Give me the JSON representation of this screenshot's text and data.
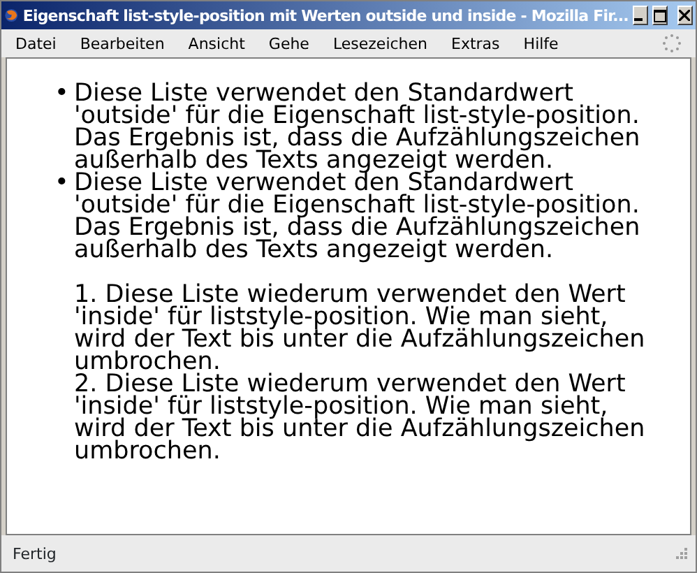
{
  "window": {
    "title": "Eigenschaft list-style-position mit Werten outside und inside - Mozilla Fir..."
  },
  "menu": [
    "Datei",
    "Bearbeiten",
    "Ansicht",
    "Gehe",
    "Lesezeichen",
    "Extras",
    "Hilfe"
  ],
  "lists": [
    {
      "kind": "outside",
      "items": [
        {
          "marker": "•",
          "text": "Diese Liste verwendet den Standardwert 'outside' für die Eigenschaft list-style-position. Das Ergebnis ist, dass die Aufzählungszeichen außerhalb des Texts angezeigt werden."
        },
        {
          "marker": "•",
          "text": "Diese Liste verwendet den Standardwert 'outside' für die Eigenschaft list-style-position. Das Ergebnis ist, dass die Aufzählungszeichen außerhalb des Texts angezeigt werden."
        }
      ]
    },
    {
      "kind": "inside",
      "items": [
        {
          "marker": "1.",
          "text": "Diese Liste wiederum verwendet den Wert 'inside' für liststyle-position. Wie man sieht, wird der Text bis unter die Aufzählungszeichen umbrochen."
        },
        {
          "marker": "2.",
          "text": "Diese Liste wiederum verwendet den Wert 'inside' für liststyle-position. Wie man sieht, wird der Text bis unter die Aufzählungszeichen umbrochen."
        }
      ]
    }
  ],
  "status_bar": {
    "text": "Fertig"
  }
}
